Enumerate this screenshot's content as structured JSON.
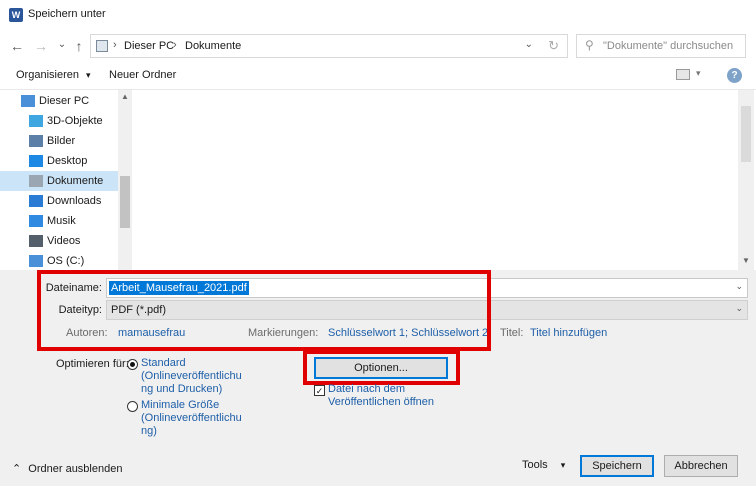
{
  "window": {
    "title": "Speichern unter",
    "app_icon": "W"
  },
  "nav": {
    "back": "←",
    "forward": "→",
    "recent": "⌄",
    "up": "↑",
    "breadcrumb": [
      "Dieser PC",
      "Dokumente"
    ],
    "separator": "›",
    "refresh": "↻",
    "search_placeholder": "\"Dokumente\" durchsuchen"
  },
  "toolbar": {
    "organize": "Organisieren",
    "organize_arrow": "▾",
    "new_folder": "Neuer Ordner",
    "help": "?"
  },
  "sidebar": {
    "items": [
      {
        "label": "Dieser PC",
        "icon": "pc-icon",
        "color": "#4a90d9"
      },
      {
        "label": "3D-Objekte",
        "icon": "cube-icon",
        "color": "#3fa7e0"
      },
      {
        "label": "Bilder",
        "icon": "pictures-icon",
        "color": "#5b7fa6"
      },
      {
        "label": "Desktop",
        "icon": "desktop-icon",
        "color": "#1e88e5"
      },
      {
        "label": "Dokumente",
        "icon": "documents-icon",
        "color": "#9aa6b2"
      },
      {
        "label": "Downloads",
        "icon": "download-icon",
        "color": "#2a7bd4"
      },
      {
        "label": "Musik",
        "icon": "music-icon",
        "color": "#2f8ae0"
      },
      {
        "label": "Videos",
        "icon": "videos-icon",
        "color": "#555f6b"
      },
      {
        "label": "OS (C:)",
        "icon": "drive-icon",
        "color": "#4a90d9"
      }
    ],
    "selected_index": 4
  },
  "form": {
    "filename_label": "Dateiname:",
    "filename_value": "Arbeit_Mausefrau_2021.pdf",
    "filetype_label": "Dateityp:",
    "filetype_value": "PDF (*.pdf)",
    "authors_label": "Autoren:",
    "authors_value": "mamausefrau",
    "tags_label": "Markierungen:",
    "tags_value": "Schlüsselwort 1; Schlüsselwort 2",
    "title_label": "Titel:",
    "title_value": "Titel hinzufügen"
  },
  "optimize": {
    "label": "Optimieren für:",
    "standard_lines": [
      "Standard",
      "(Onlineveröffentlichu",
      "ng und Drucken)"
    ],
    "minimal_lines": [
      "Minimale Größe",
      "(Onlineveröffentlichu",
      "ng)"
    ],
    "selected": "standard"
  },
  "options_button": "Optionen...",
  "open_after": {
    "lines": [
      "Datei nach dem",
      "Veröffentlichen öffnen"
    ],
    "checked": true,
    "check_glyph": "✓"
  },
  "footer": {
    "hide_folders": "Ordner ausblenden",
    "hide_arrow": "⌃",
    "tools": "Tools",
    "tools_arrow": "▾",
    "save": "Speichern",
    "cancel": "Abbrechen"
  },
  "colors": {
    "highlight": "#e00000",
    "selection": "#0078d7",
    "link": "#1e5fa8"
  }
}
